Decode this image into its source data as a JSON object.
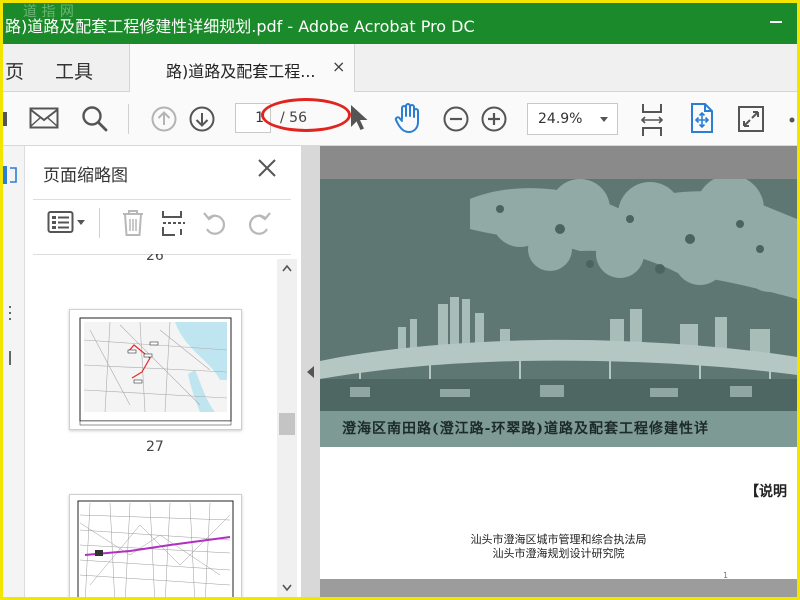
{
  "window": {
    "title": "路)道路及配套工程修建性详细规划.pdf - Adobe Acrobat Pro DC",
    "watermark": "道 指 网"
  },
  "tabs": {
    "home": "页",
    "tools": "工具",
    "document": "路)道路及配套工程...",
    "close_symbol": "×"
  },
  "toolbar": {
    "current_page": "1",
    "total_pages": "/ 56",
    "zoom": "24.9%"
  },
  "thumbnail_panel": {
    "title": "页面缩略图",
    "page_labels": [
      "26",
      "27"
    ]
  },
  "document": {
    "cover_title": "澄海区南田路(澄江路-环翠路)道路及配套工程修建性详",
    "explain_label": "【说明",
    "org_lines": [
      "汕头市澄海区城市管理和综合执法局",
      "汕头市澄海规划设计研究院"
    ],
    "page_number": "1"
  },
  "colors": {
    "titlebar": "#1b8a2a",
    "highlight_ellipse": "#e0241e",
    "accent_blue": "#2a7fd4",
    "frame_border": "#f2e600"
  }
}
